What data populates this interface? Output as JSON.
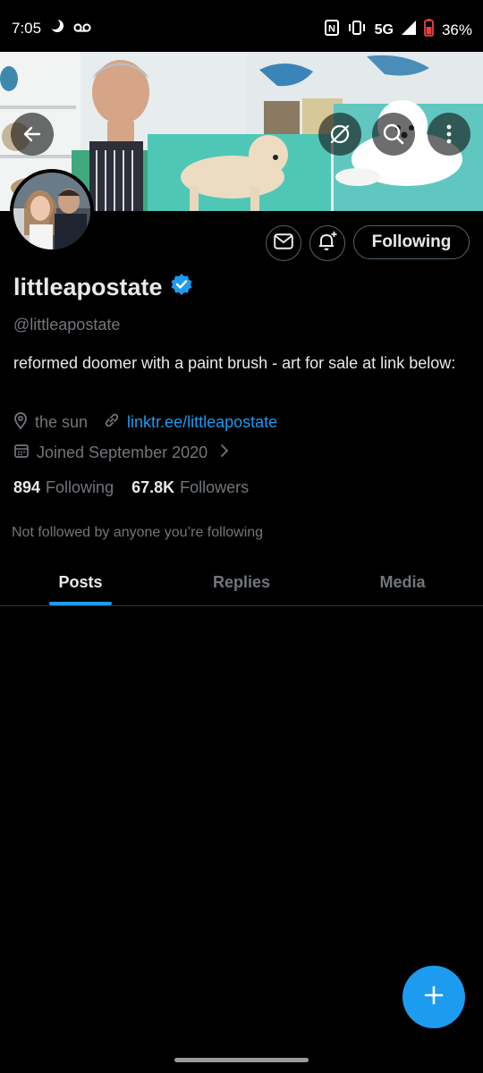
{
  "status_bar": {
    "time": "7:05",
    "network": "5G",
    "battery": "36%"
  },
  "banner": {
    "back_icon": "arrow-left-icon",
    "grok_icon": "slash-circle-icon",
    "search_icon": "search-icon",
    "more_icon": "more-vertical-icon"
  },
  "profile": {
    "display_name": "littleapostate",
    "handle": "@littleapostate",
    "bio": "reformed doomer with a paint brush - art for sale at link below:",
    "location": "the sun",
    "link": "linktr.ee/littleapostate",
    "joined": "Joined September 2020",
    "following_count": "894",
    "following_label": "Following",
    "followers_count": "67.8K",
    "followers_label": "Followers",
    "not_followed": "Not followed by anyone you’re following"
  },
  "actions": {
    "following_button": "Following",
    "message_icon": "mail-icon",
    "notify_icon": "bell-plus-icon"
  },
  "tabs": [
    {
      "label": "Posts",
      "active": true
    },
    {
      "label": "Replies",
      "active": false
    },
    {
      "label": "Media",
      "active": false
    }
  ],
  "colors": {
    "accent": "#1d9bf0",
    "background": "#000000",
    "muted_text": "#71767b",
    "primary_text": "#e7e9ea"
  }
}
